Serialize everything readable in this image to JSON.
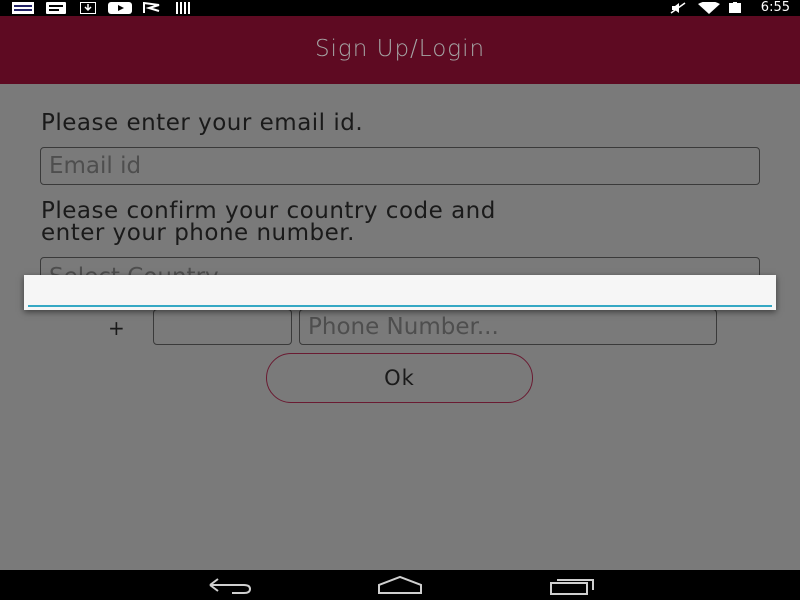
{
  "status_bar": {
    "time": "6:55",
    "left_icons": [
      "news-icon",
      "message-icon",
      "download-icon",
      "youtube-icon",
      "flag-icon",
      "barcode-icon"
    ],
    "right_icons": [
      "mute-icon",
      "wifi-icon",
      "battery-icon"
    ]
  },
  "app_bar": {
    "title": "Sign Up/Login"
  },
  "form": {
    "email_prompt": "Please enter your email id.",
    "email_placeholder": "Email id",
    "phone_prompt_line1": "Please confirm your country code and",
    "phone_prompt_line2": "enter your phone number.",
    "country_placeholder": "Select Country",
    "plus_sign": "+",
    "phone_placeholder": "Phone Number...",
    "ok_label": "Ok"
  },
  "dialog": {
    "input_value": ""
  },
  "nav_bar": {
    "buttons": [
      "back-icon",
      "home-icon",
      "recents-icon"
    ]
  },
  "colors": {
    "app_bar": "#5e0a22",
    "accent_underline": "#35a8c4",
    "scrim": "#7a7a7a"
  }
}
